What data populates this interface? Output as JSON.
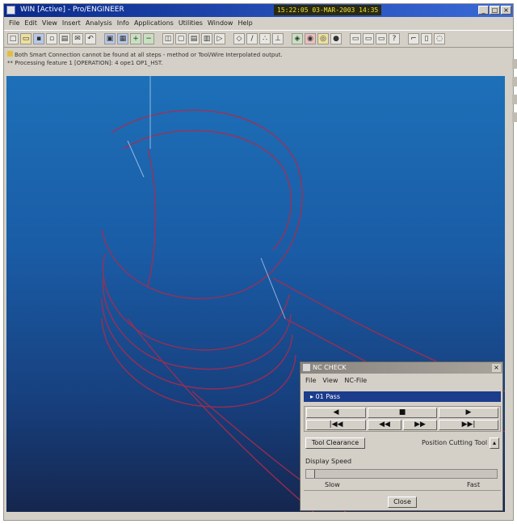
{
  "window": {
    "title": "WIN [Active] - Pro/ENGINEER",
    "clock": "15:22:05  03-MAR-2003  14:35",
    "controls": [
      "_",
      "□",
      "×"
    ]
  },
  "menu": [
    "File",
    "Edit",
    "View",
    "Insert",
    "Analysis",
    "Info",
    "Applications",
    "Utilities",
    "Window",
    "Help"
  ],
  "messages": {
    "line1": "Both Smart Connection cannot be found at all steps - method or Tool/Wire Interpolated output.",
    "line2": "** Processing feature 1 [OPERATION]: 4 ope1 OP1_HST."
  },
  "dialog": {
    "title": "NC CHECK",
    "menu": [
      "File",
      "View",
      "NC-File"
    ],
    "selected": "01 Pass",
    "play_controls": {
      "row1": [
        "◀",
        "■",
        "▶"
      ],
      "row2": [
        "|◀◀",
        "◀◀",
        "▶▶",
        "▶▶|"
      ]
    },
    "tool_clearance_btn": "Tool Clearance",
    "position_tool_label": "Position Cutting Tool",
    "display_speed_label": "Display Speed",
    "speed_level": 0.0,
    "slow_label": "Slow",
    "fast_label": "Fast",
    "close_btn": "Close"
  }
}
